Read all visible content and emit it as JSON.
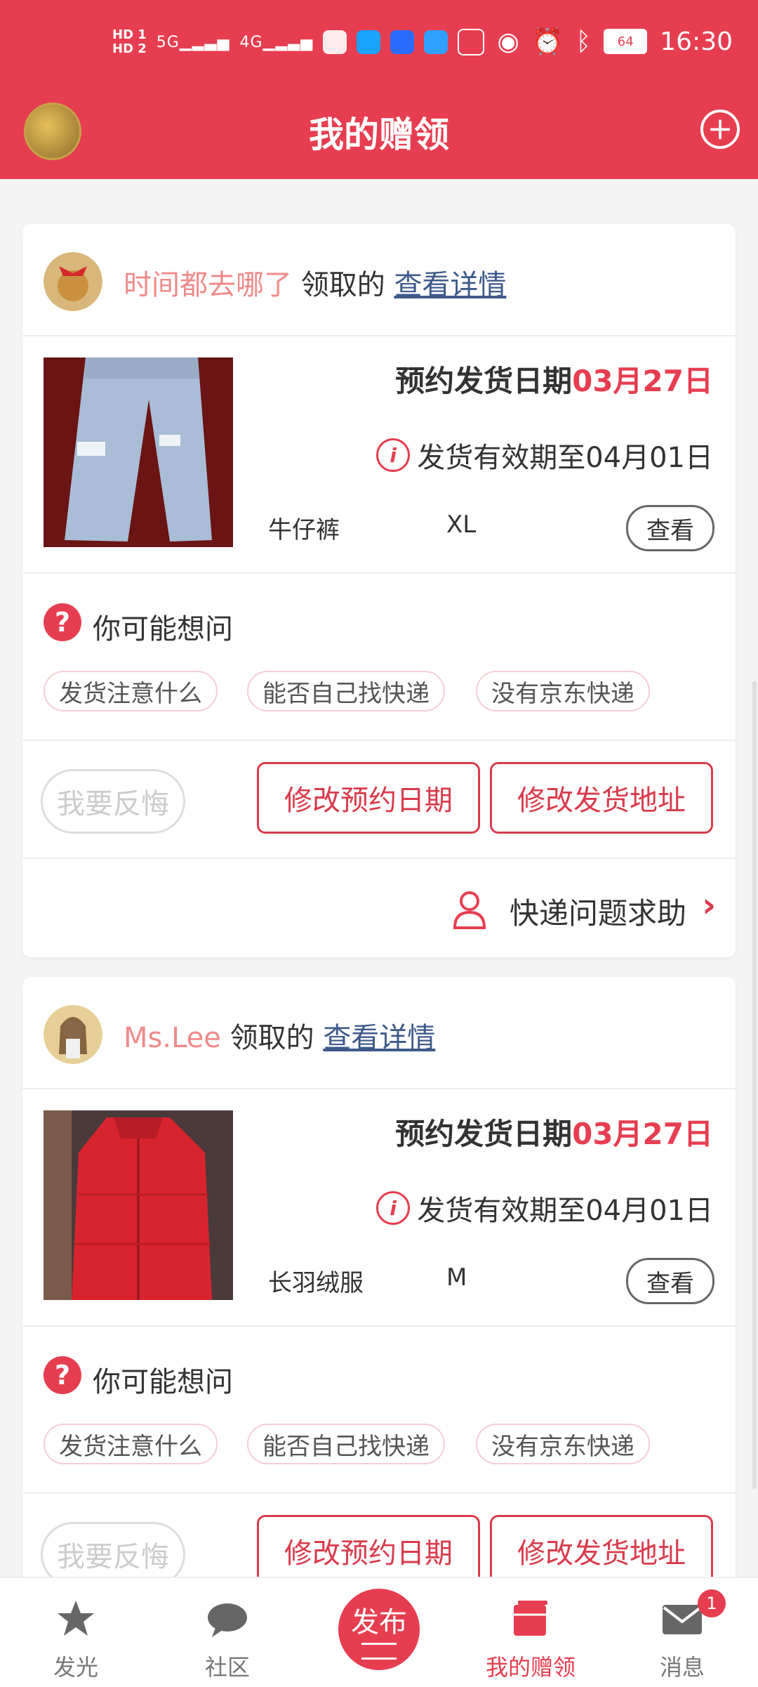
{
  "status_bar": {
    "time": "16:30",
    "battery": "64",
    "hd1": "HD 1",
    "hd2": "HD 2",
    "net1": "5G",
    "net2": "4G"
  },
  "header": {
    "title": "我的赠领"
  },
  "cards": [
    {
      "user_name": "时间都去哪了",
      "claim_text": "领取的",
      "detail_link": "查看详情",
      "date_label": "预约发货日期",
      "date_value": "03月27日",
      "valid_text": "发货有效期至04月01日",
      "item_name": "牛仔裤",
      "item_size": "XL",
      "view_label": "查看",
      "faq_title": "你可能想问",
      "chips": [
        "发货注意什么",
        "能否自己找快递",
        "没有京东快递"
      ],
      "regret_label": "我要反悔",
      "change_date_label": "修改预约日期",
      "change_addr_label": "修改发货地址",
      "help_label": "快递问题求助"
    },
    {
      "user_name": "Ms.Lee",
      "claim_text": "领取的",
      "detail_link": "查看详情",
      "date_label": "预约发货日期",
      "date_value": "03月27日",
      "valid_text": "发货有效期至04月01日",
      "item_name": "长羽绒服",
      "item_size": "M",
      "view_label": "查看",
      "faq_title": "你可能想问",
      "chips": [
        "发货注意什么",
        "能否自己找快递",
        "没有京东快递"
      ],
      "regret_label": "我要反悔",
      "change_date_label": "修改预约日期",
      "change_addr_label": "修改发货地址"
    }
  ],
  "tabs": [
    {
      "label": "发光",
      "icon": "star-icon"
    },
    {
      "label": "社区",
      "icon": "chat-icon"
    },
    {
      "label": "发布",
      "icon": "publish-icon"
    },
    {
      "label": "我的赠领",
      "icon": "gift-box-icon"
    },
    {
      "label": "消息",
      "icon": "mail-icon",
      "badge": "1"
    }
  ],
  "colors": {
    "brand": "#e63e50",
    "link": "#3d5a8a",
    "username": "#f08a8a"
  }
}
